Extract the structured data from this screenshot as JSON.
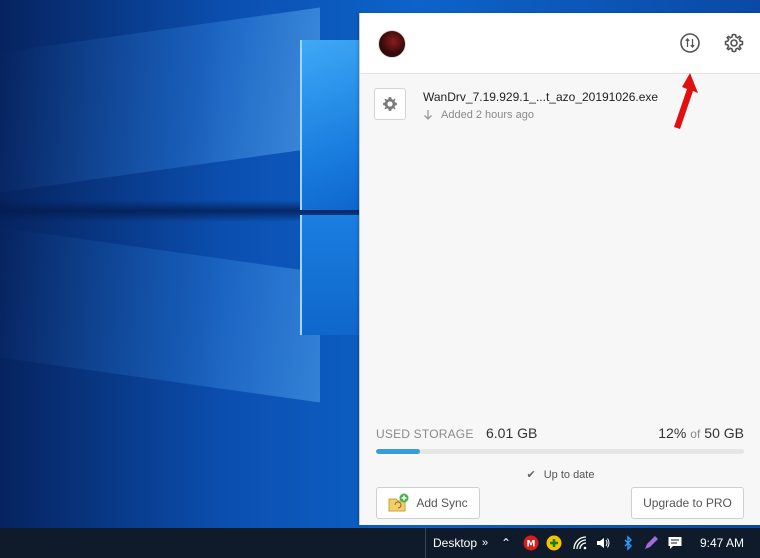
{
  "app": {
    "header": {
      "avatar_name": "avatar",
      "sync_icon": "sync-arrows-icon",
      "settings_icon": "gear-icon"
    },
    "files": [
      {
        "name": "WanDrv_7.19.929.1_...t_azo_20191026.exe",
        "status": "Added 2 hours ago",
        "icon": "gear-file-icon",
        "status_icon": "download-arrow-icon"
      }
    ],
    "storage": {
      "label": "USED STORAGE",
      "used": "6.01 GB",
      "percent_text": "12%",
      "of_text": "of",
      "total": "50 GB",
      "percent": 12
    },
    "status_text": "Up to date",
    "buttons": {
      "add_sync": "Add Sync",
      "upgrade": "Upgrade to PRO"
    },
    "colors": {
      "accent": "#3a9bdc",
      "annotation_arrow": "#e01010"
    }
  },
  "taskbar": {
    "desktop_label": "Desktop",
    "chevron": "»",
    "up_arrow": "⌃",
    "time": "9:47 AM"
  }
}
